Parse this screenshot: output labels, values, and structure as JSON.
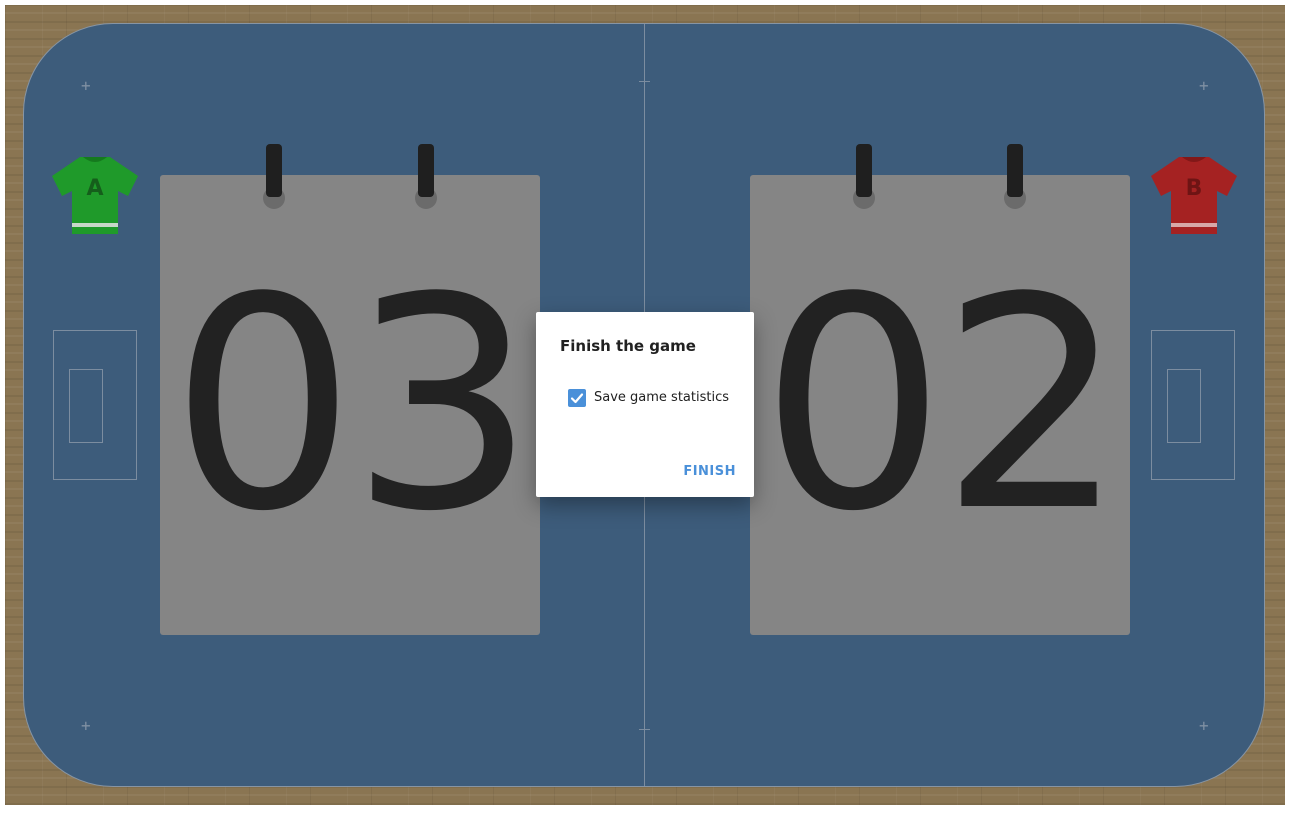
{
  "scoreboard": {
    "team_a": {
      "label": "A",
      "score": "03",
      "jersey_color": "#1f9a2a"
    },
    "team_b": {
      "label": "B",
      "score": "02",
      "jersey_color": "#a52222"
    }
  },
  "dialog": {
    "title": "Finish the game",
    "checkbox_label": "Save game statistics",
    "checkbox_checked": true,
    "finish_label": "FINISH"
  },
  "colors": {
    "court": "#3d5c7b",
    "score_card": "#858585",
    "accent": "#4a90d9"
  }
}
